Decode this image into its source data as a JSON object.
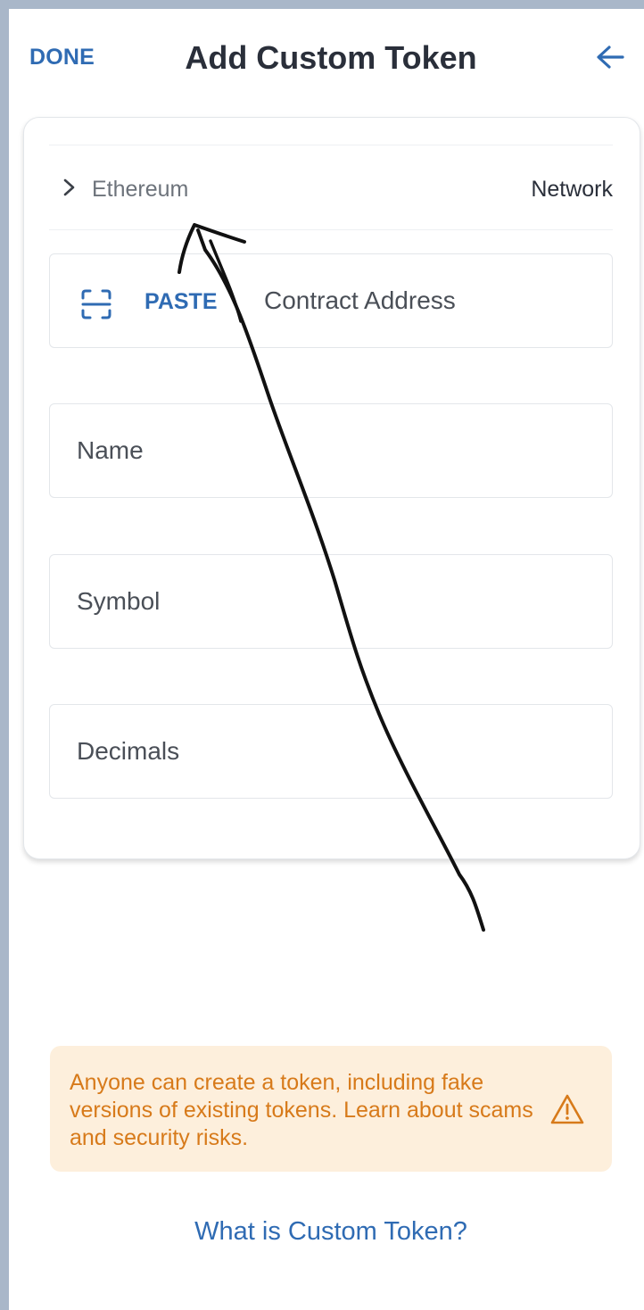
{
  "header": {
    "done_label": "DONE",
    "title": "Add Custom Token",
    "back_icon": "arrow-left-icon"
  },
  "network": {
    "value": "Ethereum",
    "label": "Network"
  },
  "fields": {
    "paste_label": "PASTE",
    "contract_address_placeholder": "Contract Address",
    "name_placeholder": "Name",
    "symbol_placeholder": "Symbol",
    "decimals_placeholder": "Decimals"
  },
  "warning": {
    "text": "Anyone can create a token, including fake versions of existing tokens. Learn about scams and security risks."
  },
  "help_link": "What is Custom Token?",
  "colors": {
    "accent": "#2f6bb3",
    "warning_bg": "#fdefdc",
    "warning_text": "#d77a1a",
    "title": "#2a2f3a"
  }
}
